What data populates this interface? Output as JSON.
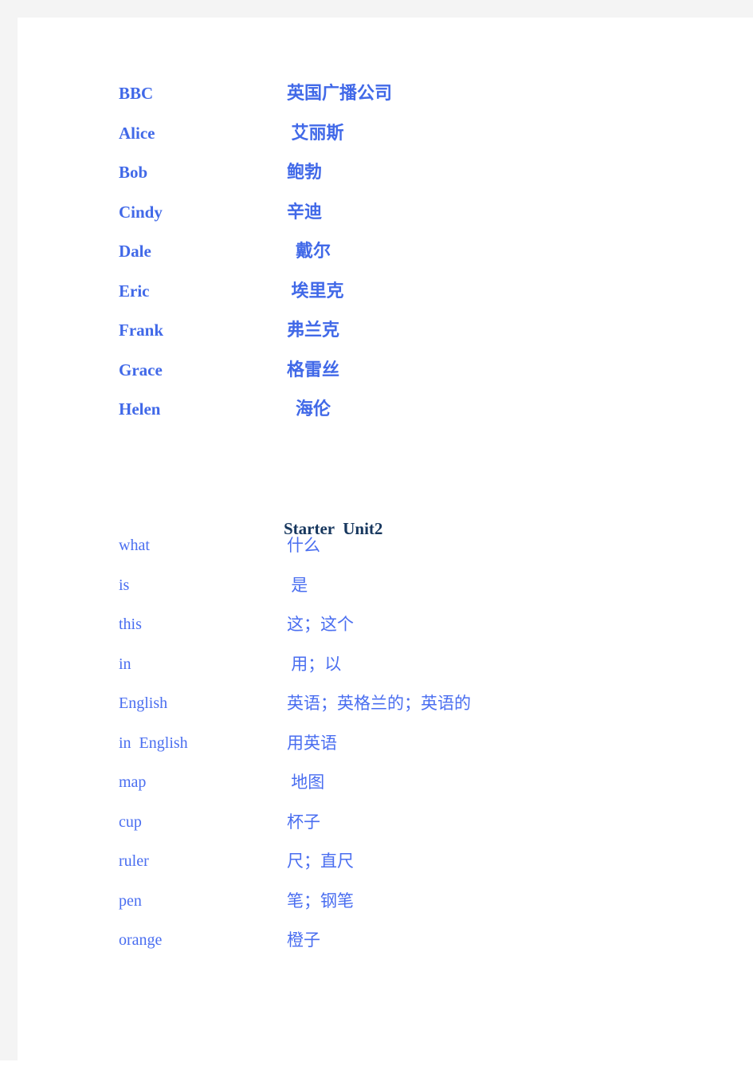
{
  "page": {
    "background_color": "#ffffff",
    "gutter_color": "#f4f4f4"
  },
  "colors": {
    "names_blue": "#4169e8",
    "words_blue": "#4a6ef0",
    "heading_navy": "#17375e"
  },
  "sections": [
    {
      "id": "proper-names",
      "style": "bold",
      "entries": [
        {
          "term": "BBC",
          "gloss": "英国广播公司"
        },
        {
          "term": "Alice",
          "gloss": " 艾丽斯"
        },
        {
          "term": "Bob",
          "gloss": "鲍勃"
        },
        {
          "term": "Cindy",
          "gloss": "辛迪"
        },
        {
          "term": "Dale",
          "gloss": "  戴尔"
        },
        {
          "term": "Eric",
          "gloss": " 埃里克"
        },
        {
          "term": "Frank",
          "gloss": "弗兰克"
        },
        {
          "term": "Grace",
          "gloss": "格雷丝"
        },
        {
          "term": "Helen",
          "gloss": "  海伦"
        }
      ]
    },
    {
      "id": "starter-unit2-words",
      "heading": "Starter  Unit2",
      "style": "regular",
      "entries": [
        {
          "term": "what",
          "gloss": "什么"
        },
        {
          "term": "is",
          "gloss": " 是"
        },
        {
          "term": "this",
          "gloss": "这；这个"
        },
        {
          "term": "in",
          "gloss": " 用；以"
        },
        {
          "term": "English",
          "gloss": "英语；英格兰的；英语的"
        },
        {
          "term": "in  English",
          "gloss": "用英语"
        },
        {
          "term": "map",
          "gloss": " 地图"
        },
        {
          "term": "cup",
          "gloss": "杯子"
        },
        {
          "term": "ruler",
          "gloss": "尺；直尺"
        },
        {
          "term": "pen",
          "gloss": "笔；钢笔"
        },
        {
          "term": "orange",
          "gloss": "橙子"
        }
      ]
    }
  ]
}
